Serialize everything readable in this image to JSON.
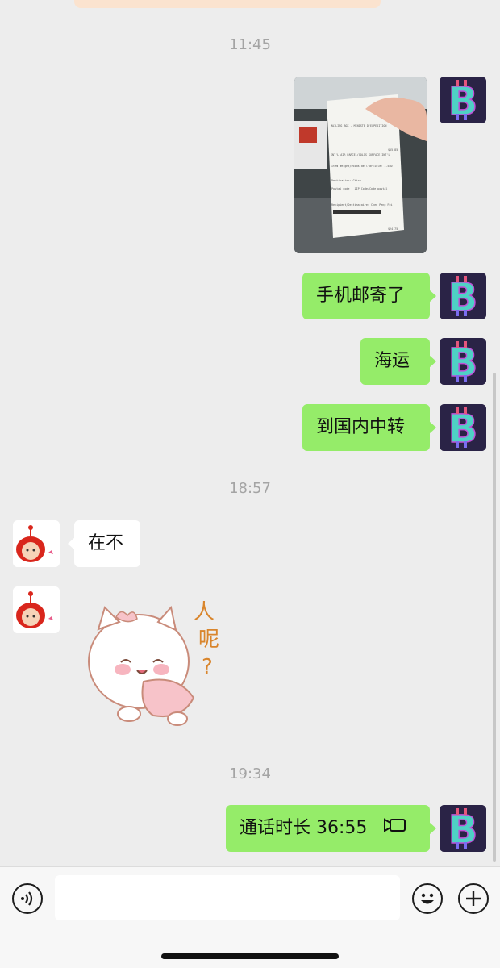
{
  "timestamps": [
    "11:45",
    "18:57",
    "19:34"
  ],
  "messages": [
    {
      "sender": "me",
      "type": "image",
      "description_icon": "receipt-photo"
    },
    {
      "sender": "me",
      "type": "text",
      "text": "手机邮寄了"
    },
    {
      "sender": "me",
      "type": "text",
      "text": "海运"
    },
    {
      "sender": "me",
      "type": "text",
      "text": "到国内中转"
    },
    {
      "sender": "other",
      "type": "text",
      "text": "在不"
    },
    {
      "sender": "other",
      "type": "sticker",
      "text": "人呢？"
    },
    {
      "sender": "me",
      "type": "call",
      "text": "通话时长 36:55"
    }
  ],
  "sticker": {
    "line1": "人",
    "line2": "呢",
    "line3": "?"
  },
  "receipt": {
    "line1": "MAILING BOX - MINISTE D'EXPEDITION",
    "line2": "INT'L AIR PARCEL/COLIS SURFACE INT'L",
    "line3": "Item Weight/Poids de l'article: 1.580",
    "line4": "Destination: China",
    "line5": "Postal code - ZIP Code/Code postal",
    "line6": "Recipient/Destinataire: Chen Peng Fei",
    "price1": "$55.85",
    "price2": "$24.75"
  },
  "input": {
    "placeholder": "",
    "value": ""
  },
  "icons": {
    "voice": "voice-icon",
    "emoji": "emoji-icon",
    "plus": "plus-icon",
    "my_avatar": "bitcoin-logo",
    "other_avatar": "red-doll-avatar"
  },
  "colors": {
    "my_bubble": "#95ec69",
    "other_bubble": "#ffffff",
    "background": "#ededed",
    "timestamp": "#a4a4a4"
  }
}
